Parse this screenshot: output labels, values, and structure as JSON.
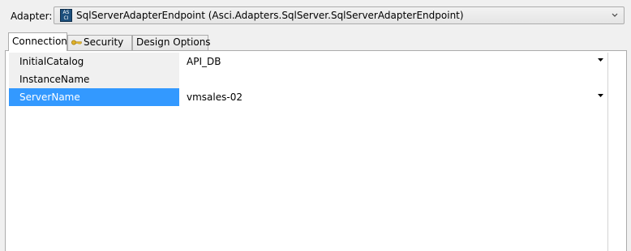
{
  "adapter": {
    "label": "Adapter:",
    "selected": "SqlServerAdapterEndpoint (Asci.Adapters.SqlServer.SqlServerAdapterEndpoint)",
    "icon": "adapter-icon",
    "icon_text_top": "AS",
    "icon_text_bottom": "CI"
  },
  "tabs": [
    {
      "label": "Connection",
      "active": true
    },
    {
      "label": "Security",
      "icon": "key-icon",
      "active": false
    },
    {
      "label": "Design Options",
      "active": false
    }
  ],
  "properties": [
    {
      "name": "InitialCatalog",
      "value": "API_DB",
      "has_dropdown": true,
      "selected": false
    },
    {
      "name": "InstanceName",
      "value": "",
      "has_dropdown": false,
      "selected": false
    },
    {
      "name": "ServerName",
      "value": "vmsales-02",
      "has_dropdown": true,
      "selected": true
    }
  ],
  "colors": {
    "selection": "#3399ff",
    "window_bg": "#f0f0f0",
    "border": "#acacac"
  }
}
